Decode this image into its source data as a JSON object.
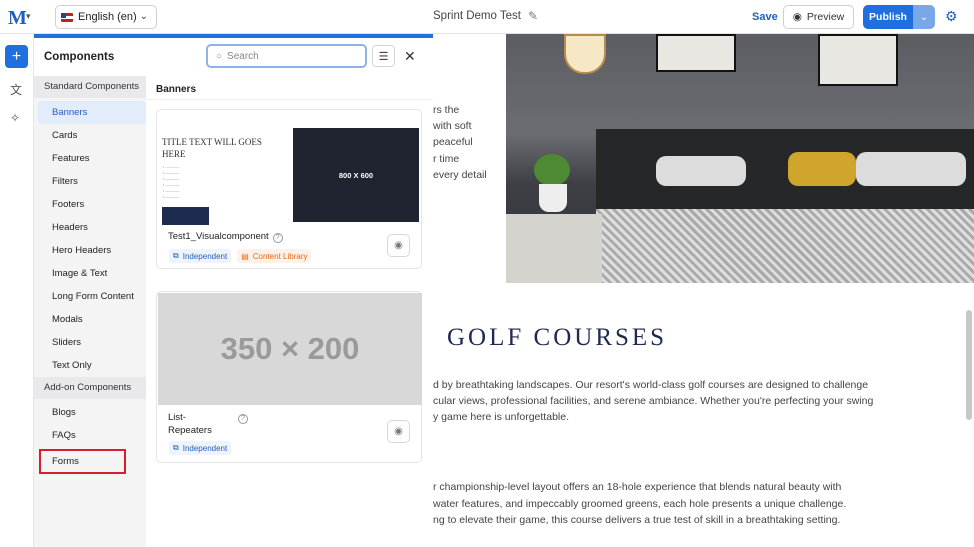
{
  "topbar": {
    "logo": "M",
    "language": "English (en)",
    "page_title": "Sprint Demo Test",
    "save_label": "Save",
    "preview_label": "Preview",
    "publish_label": "Publish"
  },
  "panel": {
    "title": "Components",
    "search_placeholder": "Search",
    "standard_header": "Standard Components",
    "standard_items": [
      "Banners",
      "Cards",
      "Features",
      "Filters",
      "Footers",
      "Headers",
      "Hero Headers",
      "Image & Text",
      "Long Form Content",
      "Modals",
      "Sliders",
      "Text Only"
    ],
    "addon_header": "Add-on Components",
    "addon_items": [
      "Blogs",
      "FAQs",
      "Forms"
    ],
    "content_heading": "Banners"
  },
  "cards": [
    {
      "name": "Test1_Visualcomponent",
      "tags": [
        "Independent",
        "Content Library"
      ],
      "thumb_title": "TITLE TEXT WILL GOES HERE",
      "thumb_placeholder": "800 X 600"
    },
    {
      "name_line1": "List-",
      "name_line2": "Repeaters",
      "tags": [
        "Independent"
      ],
      "thumb_placeholder": "350 × 200"
    }
  ],
  "canvas": {
    "side_text": [
      "rs the",
      "with soft",
      "peaceful",
      "r time",
      "every detail"
    ],
    "heading": "GOLF COURSES",
    "para1": [
      "d by breathtaking landscapes. Our resort's world-class golf courses are designed to challenge",
      "cular views, professional facilities, and serene ambiance. Whether you're perfecting your swing",
      "y game here is unforgettable."
    ],
    "para2": [
      "r championship-level layout offers an 18-hole experience that blends natural beauty with",
      "water features, and impeccably groomed greens, each hole presents a unique challenge.",
      "ng to elevate their game, this course delivers a true test of skill in a breathtaking setting."
    ]
  },
  "colors": {
    "accent": "#1f6fdf",
    "highlight": "#d61f2c"
  }
}
